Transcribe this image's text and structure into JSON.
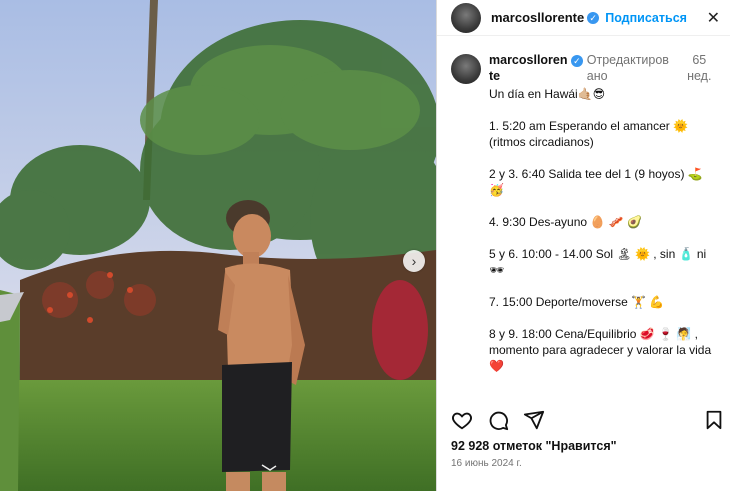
{
  "post": {
    "username": "marcosllorente",
    "follow_label": "Подписаться",
    "close_icon": "close-icon",
    "caption_username": "marcosllorente",
    "edited_label": "Отредактировано",
    "time_ago": "65 нед.",
    "caption_lines": [
      "Un día en Hawái🤙🏼😎",
      "1. 5:20 am Esperando el amancer 🌞 (ritmos circadianos)",
      "2 y 3. 6:40 Salida tee del 1 (9 hoyos) ⛳ 🥳",
      "4. 9:30 Des-ayuno 🥚 🥓 🥑",
      "5 y 6. 10:00 - 14.00 Sol 🏝 🌞 , sin 🧴 ni 🕶",
      "7. 15:00 Deporte/moverse 🏋️ 💪",
      "8 y 9. 18:00 Cena/Equilibrio 🥩 🍷 🧖 , momento para agradecer y valorar la vida❤️"
    ],
    "likes": "92 928 отметок \"Нравится\"",
    "date": "16 июнь 2024 г."
  },
  "colors": {
    "accent": "#0095f6",
    "verified": "#3897f0",
    "muted": "#737373"
  }
}
